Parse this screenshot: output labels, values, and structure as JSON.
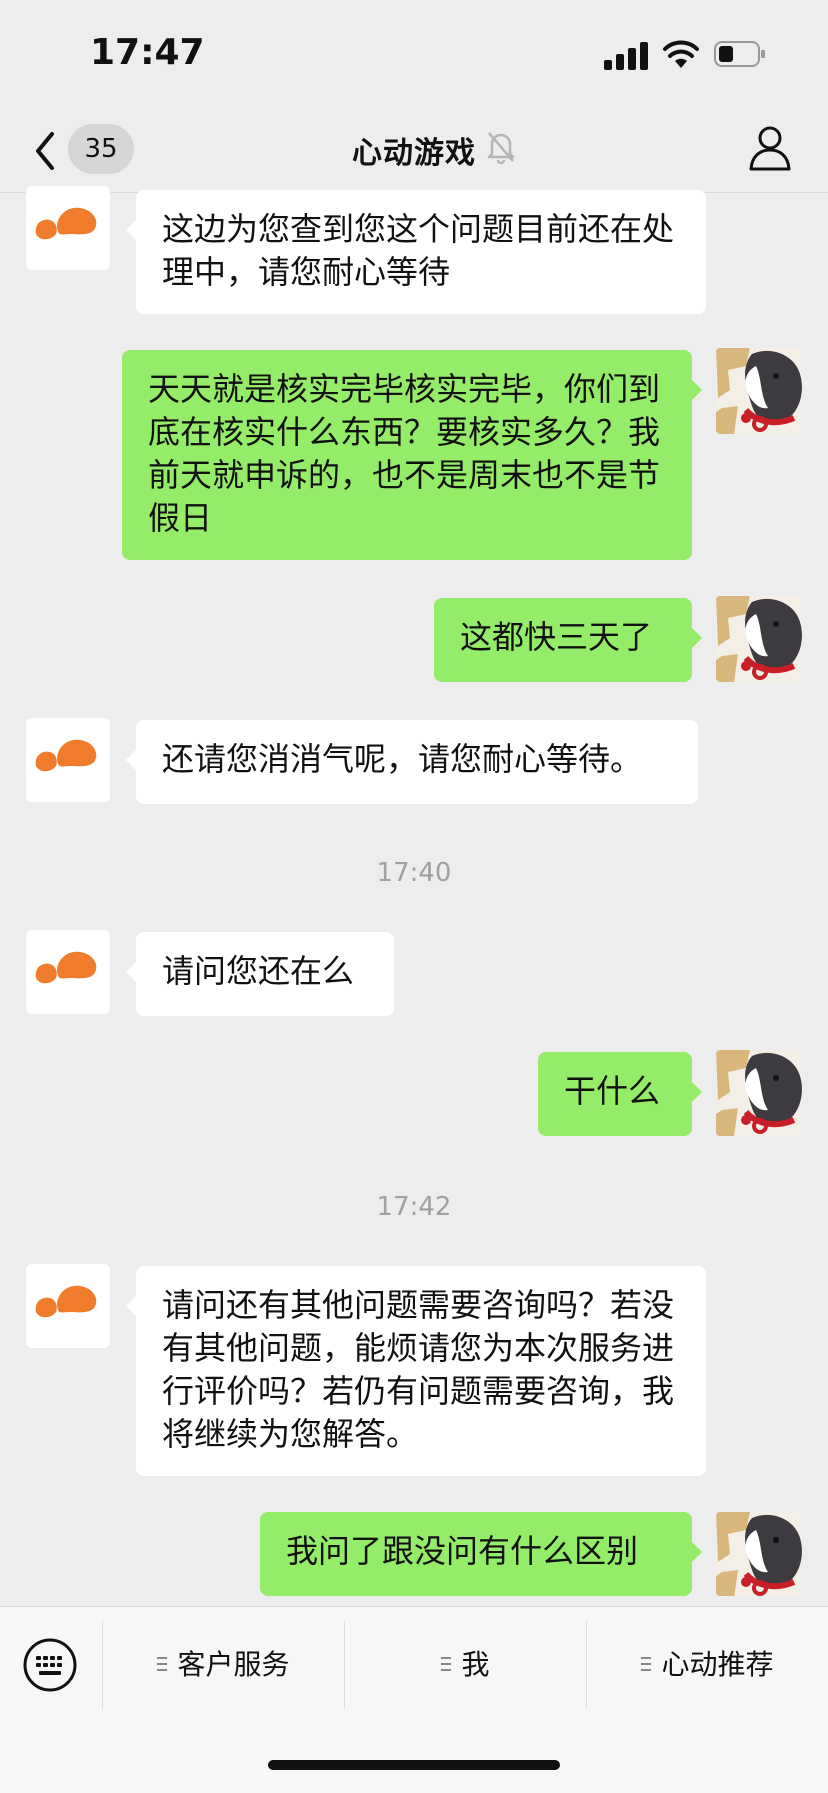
{
  "status_bar": {
    "time": "17:47"
  },
  "nav": {
    "unread_count": "35",
    "title": "心动游戏"
  },
  "messages": [
    {
      "side": "in",
      "text": "这边为您查到您这个问题目前还在处理中，请您耐心等待"
    },
    {
      "side": "out",
      "text": "天天就是核实完毕核实完毕，你们到底在核实什么东西？要核实多久？我前天就申诉的，也不是周末也不是节假日"
    },
    {
      "side": "out",
      "text": "这都快三天了"
    },
    {
      "side": "in",
      "text": "还请您消消气呢，请您耐心等待。"
    },
    {
      "timestamp": "17:40"
    },
    {
      "side": "in",
      "text": "请问您还在么"
    },
    {
      "side": "out",
      "text": "干什么"
    },
    {
      "timestamp": "17:42"
    },
    {
      "side": "in",
      "text": "请问还有其他问题需要咨询吗？若没有其他问题，能烦请您为本次服务进行评价吗？若仍有问题需要咨询，我将继续为您解答。"
    },
    {
      "side": "out",
      "text": "我问了跟没问有什么区别"
    }
  ],
  "bottom_menu": [
    "客户服务",
    "我",
    "心动推荐"
  ],
  "colors": {
    "outgoing_bubble": "#95ec69",
    "incoming_bubble": "#ffffff",
    "brand_orange": "#f07b2a"
  }
}
